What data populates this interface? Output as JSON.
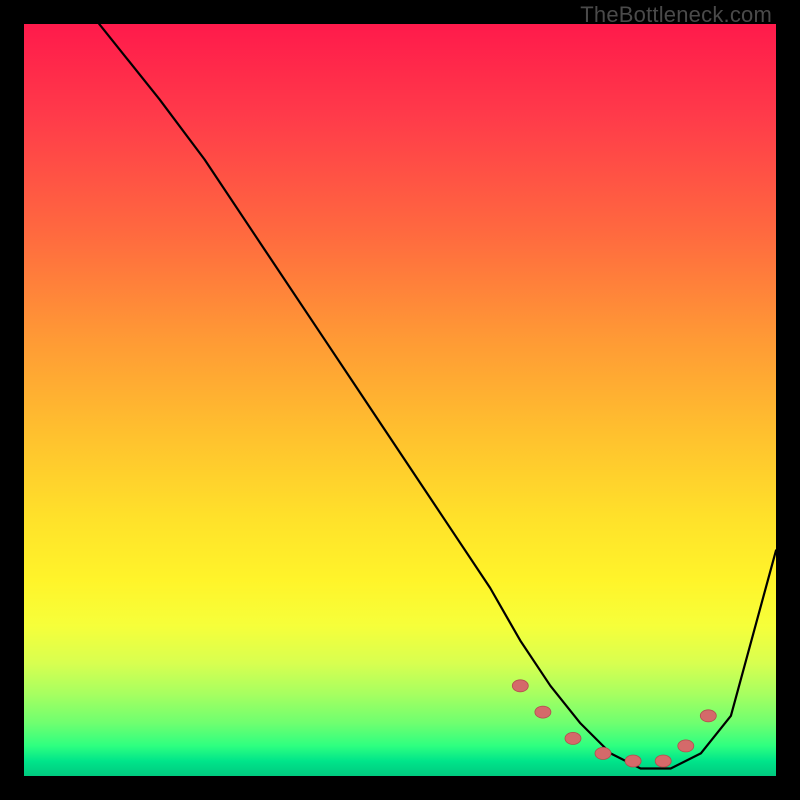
{
  "watermark": {
    "text": "TheBottleneck.com"
  },
  "colors": {
    "curve": "#000000",
    "nub_fill": "#d46a6a",
    "nub_stroke": "#b34d4d"
  },
  "chart_data": {
    "type": "line",
    "title": "",
    "xlabel": "",
    "ylabel": "",
    "xlim": [
      0,
      100
    ],
    "ylim": [
      0,
      100
    ],
    "note": "No axis ticks, labels, or numeric data are visible in the image; the curve and markers are inferred from the pixels only.",
    "series": [
      {
        "name": "bottleneck-curve",
        "x": [
          10,
          14,
          18,
          24,
          32,
          40,
          48,
          56,
          62,
          66,
          70,
          74,
          78,
          82,
          86,
          90,
          94,
          100
        ],
        "y": [
          100,
          95,
          90,
          82,
          70,
          58,
          46,
          34,
          25,
          18,
          12,
          7,
          3,
          1,
          1,
          3,
          8,
          30
        ]
      }
    ],
    "markers": [
      {
        "name": "nub-1",
        "x": 66,
        "y": 12
      },
      {
        "name": "nub-2",
        "x": 69,
        "y": 8.5
      },
      {
        "name": "nub-3",
        "x": 73,
        "y": 5
      },
      {
        "name": "nub-4",
        "x": 77,
        "y": 3
      },
      {
        "name": "nub-5",
        "x": 81,
        "y": 2
      },
      {
        "name": "nub-6",
        "x": 85,
        "y": 2
      },
      {
        "name": "nub-7",
        "x": 88,
        "y": 4
      },
      {
        "name": "nub-8",
        "x": 91,
        "y": 8
      }
    ]
  }
}
